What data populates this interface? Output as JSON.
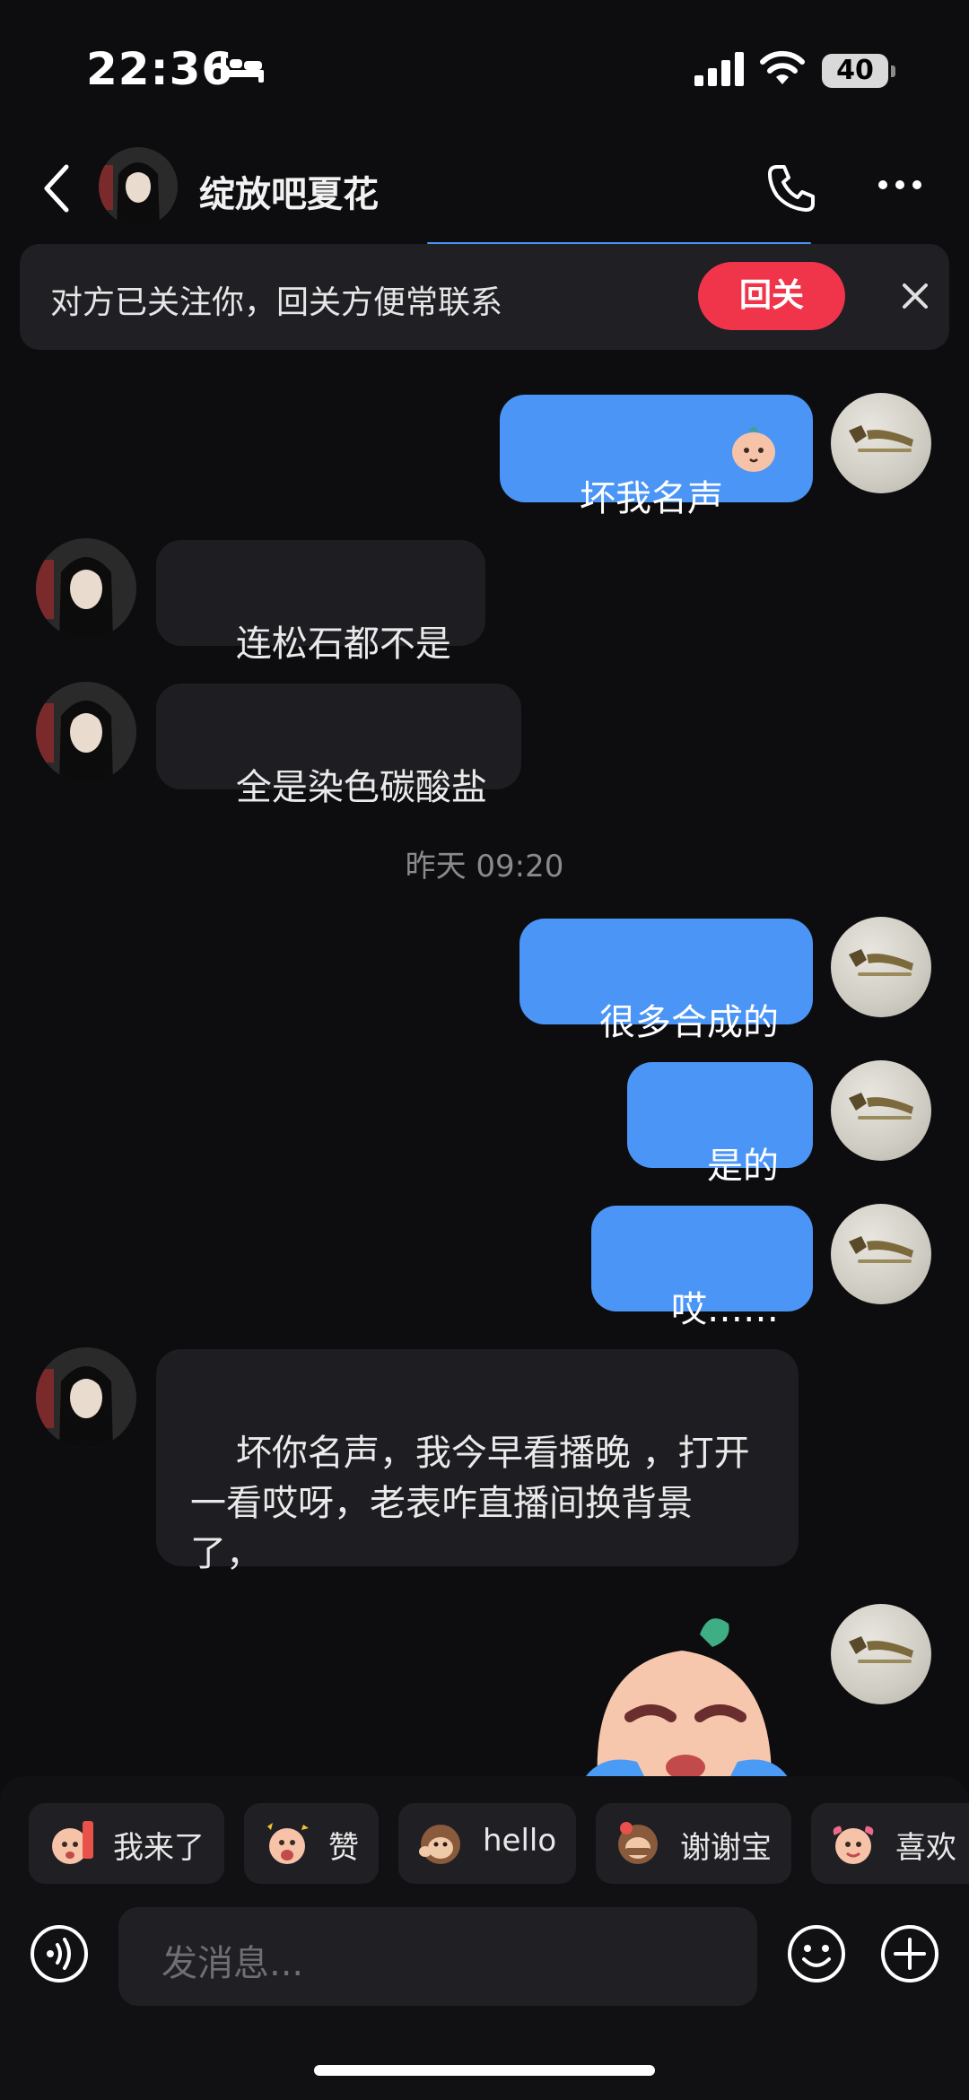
{
  "status_bar": {
    "time": "22:36",
    "battery": "40"
  },
  "header": {
    "name": "绽放吧夏花"
  },
  "follow_banner": {
    "text": "对方已关注你，回关方便常联系",
    "button": "回关"
  },
  "messages": [
    {
      "side": "mine",
      "text": "坏我名声"
    },
    {
      "side": "theirs",
      "text": "连松石都不是"
    },
    {
      "side": "theirs",
      "text": "全是染色碳酸盐"
    },
    {
      "side": "timestamp",
      "text": "昨天 09:20"
    },
    {
      "side": "mine",
      "text": "很多合成的"
    },
    {
      "side": "mine",
      "text": "是的"
    },
    {
      "side": "mine",
      "text": "哎……"
    },
    {
      "side": "theirs",
      "text": "坏你名声，我今早看播晚 ，打开\n一看哎呀，老表咋直播间换背景\n了，"
    }
  ],
  "quick_replies": [
    {
      "label": "我来了",
      "icon": "sticker-coming-icon"
    },
    {
      "label": "赞",
      "icon": "sticker-like-icon"
    },
    {
      "label": "hello",
      "icon": "sticker-hello-icon"
    },
    {
      "label": "谢谢宝",
      "icon": "sticker-thanks-icon"
    },
    {
      "label": "喜欢",
      "icon": "sticker-love-icon"
    }
  ],
  "composer": {
    "placeholder": "发消息..."
  },
  "colors": {
    "background": "#0d0d10",
    "my_bubble": "#4a95f5",
    "their_bubble": "#1d1d22",
    "follow_button": "#f0354a"
  }
}
